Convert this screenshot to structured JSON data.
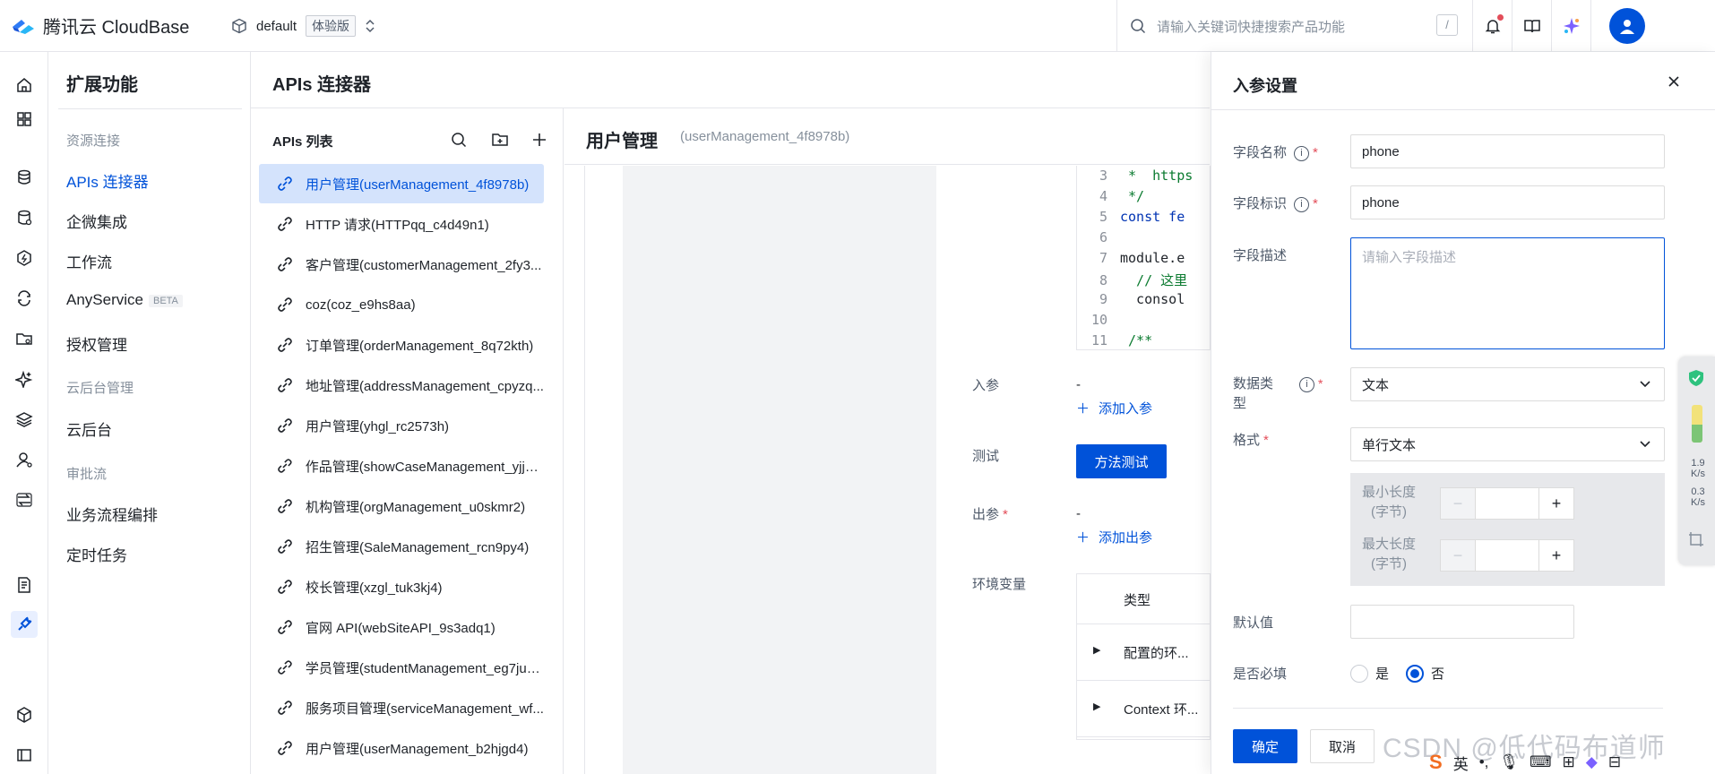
{
  "topbar": {
    "brand": "腾讯云 CloudBase",
    "env_name": "default",
    "env_badge": "体验版",
    "search_placeholder": "请输入关键词快捷搜索产品功能",
    "search_shortcut": "/"
  },
  "ext_sidebar": {
    "title": "扩展功能",
    "sections": [
      {
        "header": "资源连接",
        "items": [
          "APIs 连接器",
          "企微集成",
          "工作流"
        ]
      },
      {
        "any_service": "AnyService",
        "beta": "BETA",
        "auth": "授权管理"
      },
      {
        "header": "云后台管理",
        "items": [
          "云后台"
        ]
      },
      {
        "header": "审批流",
        "items": [
          "业务流程编排",
          "定时任务"
        ]
      }
    ]
  },
  "main": {
    "title": "APIs 连接器",
    "list_title": "APIs 列表",
    "apis": [
      "用户管理(userManagement_4f8978b)",
      "HTTP 请求(HTTPqq_c4d49n1)",
      "客户管理(customerManagement_2fy3...",
      "coz(coz_e9hs8aa)",
      "订单管理(orderManagement_8q72kth)",
      "地址管理(addressManagement_cpyzq...",
      "用户管理(yhgl_rc2573h)",
      "作品管理(showCaseManagement_yjjm...",
      "机构管理(orgManagement_u0skmr2)",
      "招生管理(SaleManagement_rcn9py4)",
      "校长管理(xzgl_tuk3kj4)",
      "官网 API(webSiteAPI_9s3adq1)",
      "学员管理(studentManagement_eg7jud...",
      "服务项目管理(serviceManagement_wf...",
      "用户管理(userManagement_b2hjgd4)"
    ]
  },
  "detail": {
    "title": "用户管理",
    "subtitle": "(userManagement_4f8978b)",
    "code_lines": [
      {
        "n": "3",
        "t": " *  https"
      },
      {
        "n": "4",
        "t": " */"
      },
      {
        "n": "5",
        "t": "const fe"
      },
      {
        "n": "6",
        "t": ""
      },
      {
        "n": "7",
        "t": "module.e"
      },
      {
        "n": "8",
        "t": "  // 这里"
      },
      {
        "n": "9",
        "t": "  consol"
      },
      {
        "n": "10",
        "t": ""
      },
      {
        "n": "11",
        "t": " /**"
      }
    ],
    "input_label": "入参",
    "input_value": "-",
    "add_input": "添加入参",
    "test_label": "测试",
    "test_button": "方法测试",
    "output_label": "出参",
    "output_value": "-",
    "add_output": "添加出参",
    "env_label": "环境变量",
    "env_col_type": "类型",
    "env_rows": [
      "配置的环...",
      "Context 环..."
    ]
  },
  "drawer": {
    "title": "入参设置",
    "field_name_label": "字段名称",
    "field_name_value": "phone",
    "field_key_label": "字段标识",
    "field_key_value": "phone",
    "field_desc_label": "字段描述",
    "field_desc_placeholder": "请输入字段描述",
    "data_type_label_1": "数据类",
    "data_type_label_2": "型",
    "data_type_value": "文本",
    "format_label": "格式",
    "format_value": "单行文本",
    "min_len_label_1": "最小长度",
    "min_len_label_2": "(字节)",
    "max_len_label_1": "最大长度",
    "max_len_label_2": "(字节)",
    "default_label": "默认值",
    "required_label": "是否必填",
    "required_yes": "是",
    "required_no": "否",
    "required_selected": "否",
    "ok_button": "确定",
    "cancel_button": "取消"
  },
  "overlay": {
    "watermark": "CSDN @低代码布道师",
    "net_up": "1.9",
    "net_down": "0.3",
    "net_unit": "K/s",
    "ime_lang": "英"
  },
  "colors": {
    "primary": "#0052d9",
    "danger": "#e34d59",
    "selected_bg": "#d4e3fc"
  }
}
